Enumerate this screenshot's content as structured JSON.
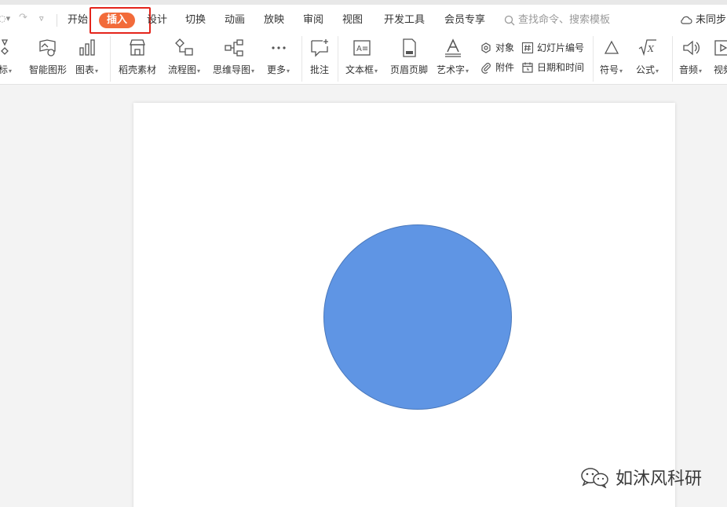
{
  "tabs": {
    "home": "开始",
    "insert": "插入",
    "design": "设计",
    "transition": "切换",
    "animation": "动画",
    "slideshow": "放映",
    "review": "审阅",
    "view": "视图",
    "developer": "开发工具",
    "member": "会员专享",
    "active": "插入"
  },
  "search": {
    "placeholder": "查找命令、搜索模板"
  },
  "sync": {
    "label": "未同步"
  },
  "ribbon": {
    "icon_label": "图标",
    "smartart_label": "智能图形",
    "chart_label": "图表",
    "material_label": "稻壳素材",
    "flowchart_label": "流程图",
    "mindmap_label": "思维导图",
    "more_label": "更多",
    "comment_label": "批注",
    "textbox_label": "文本框",
    "header_footer_label": "页眉页脚",
    "wordart_label": "艺术字",
    "object_label": "对象",
    "attachment_label": "附件",
    "slide_number_label": "幻灯片编号",
    "datetime_label": "日期和时间",
    "symbol_label": "符号",
    "formula_label": "公式",
    "audio_label": "音频",
    "video_label": "视频"
  },
  "watermark": {
    "text": "如沐风科研"
  },
  "colors": {
    "accent": "#f26b3a",
    "highlight_border": "#e4241b",
    "shape_fill": "#5f95e4",
    "shape_stroke": "#4a78bb"
  }
}
